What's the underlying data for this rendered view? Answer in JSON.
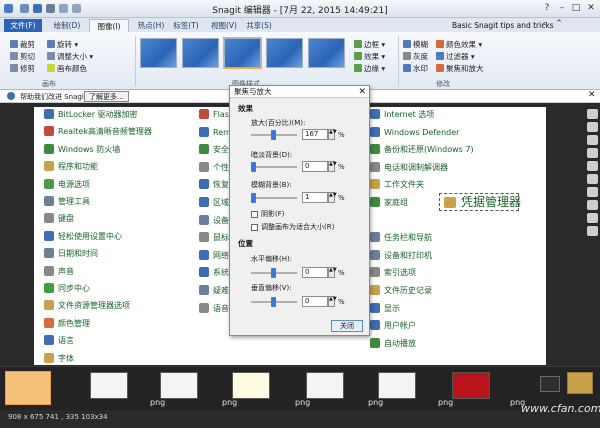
{
  "window": {
    "title": "Snagit 编辑器 - [7月 22, 2015 14:49:21]"
  },
  "tabs": [
    "文件(F)",
    "绘制(D)",
    "图像(I)",
    "热点(H)",
    "标签(T)",
    "视图(V)",
    "共享(S)"
  ],
  "help_text": "Basic Snagit tips and tricks",
  "ribbon": {
    "left_tools": [
      "裁剪",
      "旋转",
      "剪切",
      "调整大小",
      "修剪",
      "画布颜色"
    ],
    "group_canvas": "画布",
    "group_styles": "图像样式",
    "mid_tools": [
      "边框",
      "效果",
      "边缘"
    ],
    "right_tools": [
      "模糊",
      "颜色效果",
      "灰度",
      "过滤器",
      "水印",
      "聚焦和放大"
    ],
    "group_modify": "修改"
  },
  "info": {
    "text": "帮助我们改进 Snagit",
    "button": "了解更多..."
  },
  "canvas": {
    "col1": [
      "BitLocker 驱动器加密",
      "Realtek高清晰音频管理器",
      "Windows 防火墙",
      "程序和功能",
      "电源选项",
      "管理工具",
      "键盘",
      "轻松使用设置中心",
      "日期和时间",
      "声音",
      "同步中心",
      "文件资源管理器选项",
      "颜色管理",
      "语言",
      "字体"
    ],
    "col2": [
      "Flas",
      "Rem",
      "安全",
      "个性",
      "恢复",
      "区域",
      "设备",
      "鼠标",
      "网络",
      "系统",
      "疑难",
      "语音识别"
    ],
    "col3": [
      "Internet 选项",
      "Windows Defender",
      "备份和还原(Windows 7)",
      "电话和调制解调器",
      "工作文件夹",
      "家庭组",
      "凭据管理器",
      "任务栏和导航",
      "设备和打印机",
      "索引选项",
      "文件历史记录",
      "显示",
      "用户帐户",
      "自动播放"
    ],
    "highlight": "凭据管理器"
  },
  "dialog": {
    "title": "聚焦与放大",
    "close": "✕",
    "effects_label": "效果",
    "zoom_label": "放大(百分比)(M):",
    "zoom_value": "167",
    "dim_label": "暗淡背景(D):",
    "dim_value": "0",
    "blur_label": "模糊背景(B):",
    "blur_value": "1",
    "unit": "%",
    "shadow_label": "阴影(F)",
    "resize_label": "调整画布为适合大小(R)",
    "position_label": "位置",
    "hoffset_label": "水平偏移(H):",
    "hoffset_value": "0",
    "voffset_label": "垂直偏移(V):",
    "voffset_value": "0",
    "close_button": "关闭"
  },
  "tray": {
    "labels": [
      "png",
      "png",
      "png",
      "png",
      "png",
      "png",
      "png"
    ]
  },
  "status": "908 x 675    741 , 335  103x34",
  "watermark": "www.cfan.com.cn"
}
